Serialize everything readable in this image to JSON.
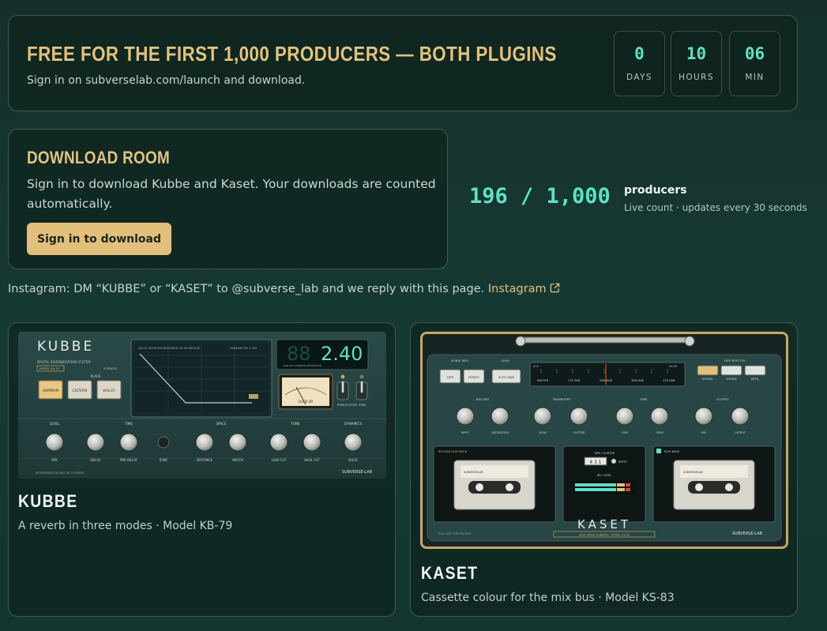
{
  "banner": {
    "title": "FREE FOR THE FIRST 1,000 PRODUCERS — BOTH PLUGINS",
    "subtitle": "Sign in on subverselab.com/launch and download.",
    "countdown": [
      {
        "value": "0",
        "label": "DAYS"
      },
      {
        "value": "10",
        "label": "HOURS"
      },
      {
        "value": "06",
        "label": "MIN"
      }
    ]
  },
  "download_room": {
    "title": "DOWNLOAD ROOM",
    "description": "Sign in to download Kubbe and Kaset. Your downloads are counted automatically.",
    "button_label": "Sign in to download"
  },
  "counter": {
    "value": "196 / 1,000",
    "label": "producers",
    "sublabel": "Live count · updates every 30 seconds"
  },
  "instagram": {
    "text": "Instagram: DM “KUBBE” or “KASET” to @subverse_lab and we reply with this page.",
    "link_label": "Instagram"
  },
  "products": [
    {
      "name": "KUBBE",
      "description": "A reverb in three modes · Model KB-79",
      "ui": {
        "logo": "KUBBE",
        "subtitle": "DIGITAL REVERBERATION SYSTEM",
        "model_badge": "MODEL KB-79",
        "spaces_label": "3 SPACES",
        "place_label": "PLACE",
        "modes": [
          "HAMMAM",
          "CISTERN",
          "VALLEY"
        ],
        "display_readout": "2.40",
        "display_ghost": "88",
        "display_caption": "DECAY DURATION   MEASURED ON AN IMPULSE",
        "display_caption2": "HAMMAM   T60 2.40S",
        "lcd_sub": "RAD SEC   HAMMAM   RESONATOR",
        "meter_label": "DUCK dB",
        "switch_labels": [
          "FREEZE",
          "ECHO",
          "SYNC"
        ],
        "groups": [
          "LEVEL",
          "TIME",
          "SPACE",
          "TONE",
          "DYNAMICS"
        ],
        "knobs": [
          "MIX",
          "DECAY",
          "PRE-DELAY",
          "SYNC",
          "DISTANCE",
          "WIDTH",
          "LOW CUT",
          "HIGH CUT",
          "DUCK"
        ],
        "footer_left": "REVERBERATION UNIT KB-79 SERIES",
        "brand": "SUBVERSE-LAB"
      }
    },
    {
      "name": "KASET",
      "description": "Cassette colour for the mix bus · Model KS-83",
      "ui": {
        "logo": "KASET",
        "signal_path": "SIGNAL PATH",
        "level": "LEVEL",
        "path_buttons": [
          "TAPE",
          "BYPASS",
          "AUTO GAIN"
        ],
        "tape_selector": "TAPE SELECTOR",
        "tape_types": [
          "NORMAL",
          "CHROME",
          "METAL"
        ],
        "dial_labels": [
          "MASTER",
          "1ST DUB",
          "2ND DUB",
          "3RD DUB",
          "4TH DUB"
        ],
        "dial_ends": [
          "NOS",
          "WORN"
        ],
        "groups": [
          "RECORD",
          "TRANSPORT",
          "TAPE",
          "OUTPUT"
        ],
        "knobs": [
          "INPUT",
          "SATURATION",
          "WOW",
          "FLUTTER",
          "HISS",
          "HEAD",
          "MIX",
          "OUTPUT"
        ],
        "deck_left": "RECORD   PLAY BACK",
        "deck_right": "PLAY BACK",
        "tape_counter_label": "TAPE COUNTER",
        "tape_counter": "4 3 1",
        "reset": "RESET",
        "rec_level": "REC LEVEL",
        "cassette_label": "SUBVERSELAB",
        "tagline": "HIGH SPEED DUBBING · MODEL KS-83",
        "footer_left": "REAL TIME TAPE MACHINE",
        "brand": "SUBVERSE-LAB"
      }
    }
  ],
  "colors": {
    "accent_gold": "#e2c07c",
    "accent_teal": "#5fe0c4",
    "background": "#15302a"
  }
}
